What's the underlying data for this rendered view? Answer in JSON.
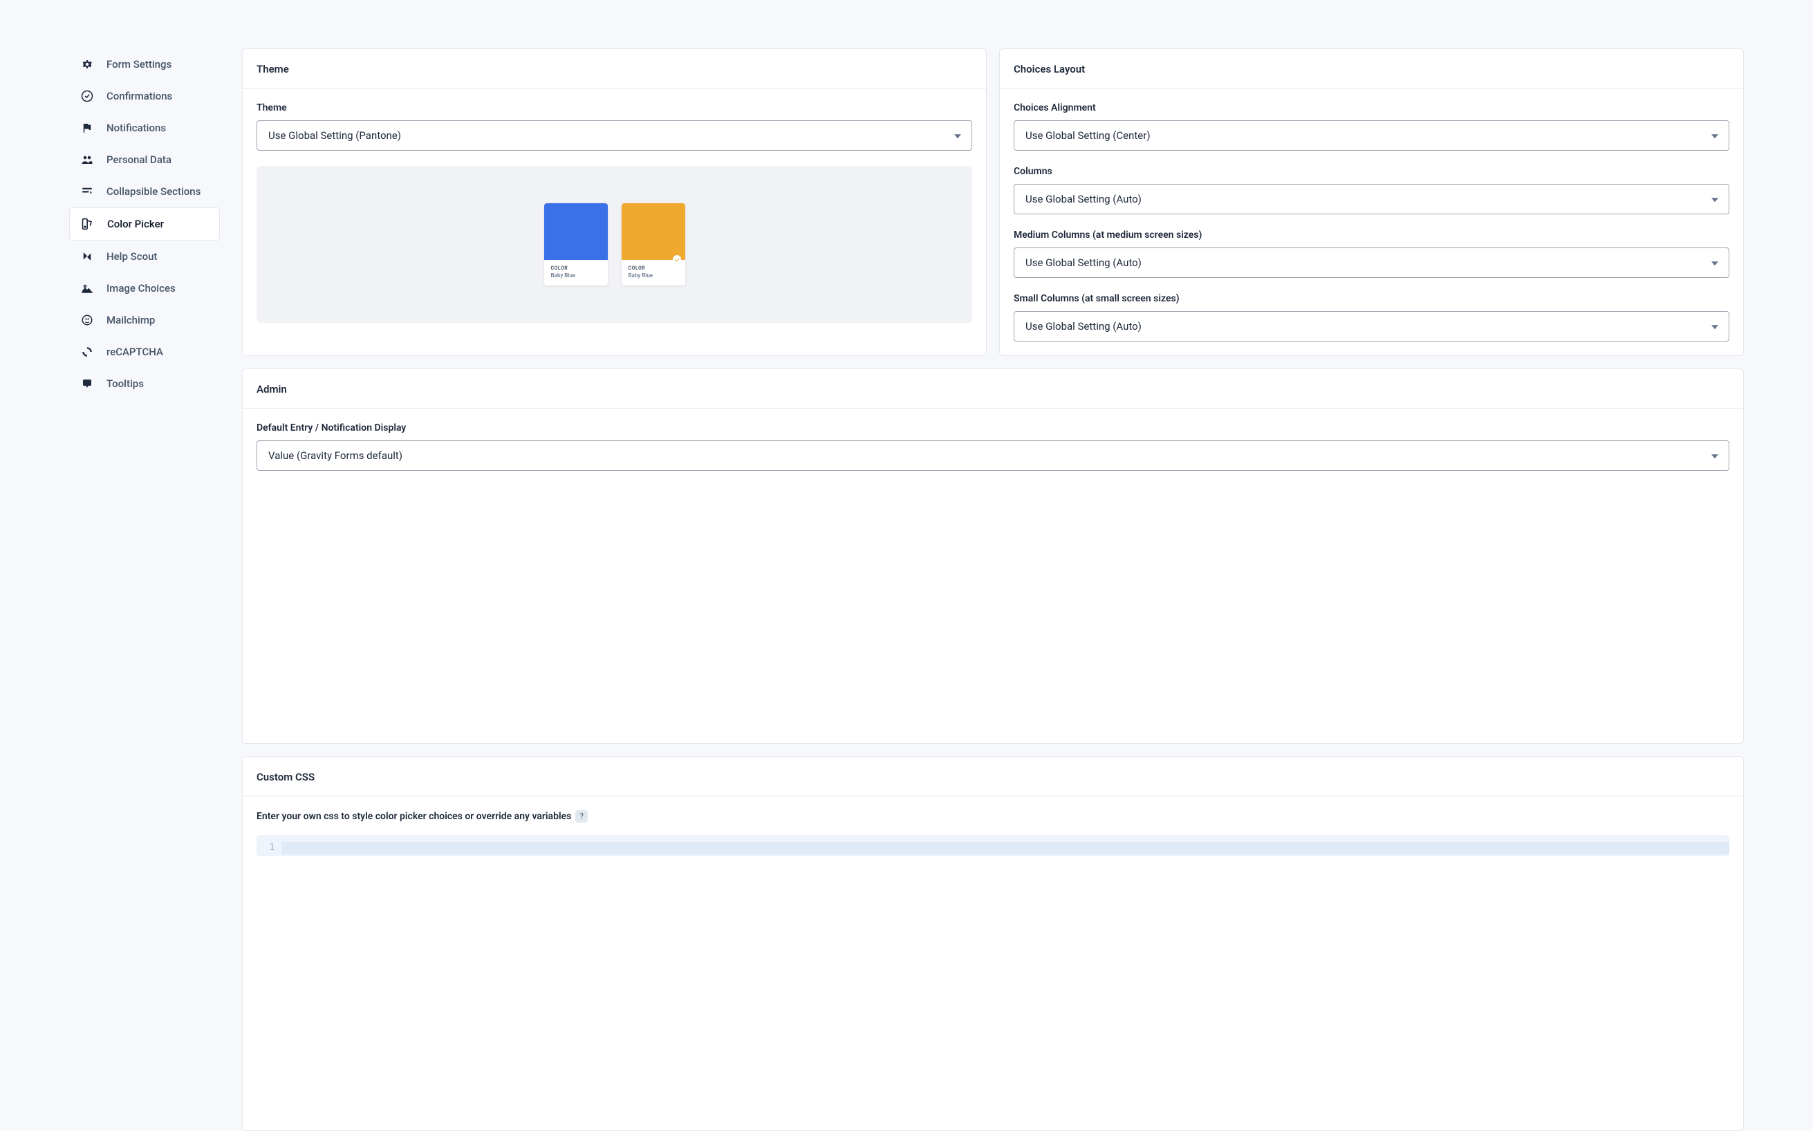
{
  "sidebar": {
    "items": [
      {
        "label": "Form Settings",
        "icon": "gear-icon"
      },
      {
        "label": "Confirmations",
        "icon": "check-circle-icon"
      },
      {
        "label": "Notifications",
        "icon": "flag-icon"
      },
      {
        "label": "Personal Data",
        "icon": "people-icon"
      },
      {
        "label": "Collapsible Sections",
        "icon": "sections-icon"
      },
      {
        "label": "Color Picker",
        "icon": "palette-icon",
        "active": true
      },
      {
        "label": "Help Scout",
        "icon": "helpscout-icon"
      },
      {
        "label": "Image Choices",
        "icon": "image-icon"
      },
      {
        "label": "Mailchimp",
        "icon": "mailchimp-icon"
      },
      {
        "label": "reCAPTCHA",
        "icon": "recaptcha-icon"
      },
      {
        "label": "Tooltips",
        "icon": "tooltip-icon"
      }
    ]
  },
  "theme": {
    "title": "Theme",
    "fields": {
      "theme": {
        "label": "Theme",
        "value": "Use Global Setting (Pantone)"
      }
    },
    "swatches": [
      {
        "category": "COLOR",
        "name": "Baby Blue",
        "color": "#3b71e8",
        "checked": false
      },
      {
        "category": "COLOR",
        "name": "Baby Blue",
        "color": "#f0a92f",
        "checked": true
      }
    ]
  },
  "choices_layout": {
    "title": "Choices Layout",
    "fields": {
      "alignment": {
        "label": "Choices Alignment",
        "value": "Use Global Setting (Center)"
      },
      "columns": {
        "label": "Columns",
        "value": "Use Global Setting (Auto)"
      },
      "medium_columns": {
        "label": "Medium Columns (at medium screen sizes)",
        "value": "Use Global Setting (Auto)"
      },
      "small_columns": {
        "label": "Small Columns (at small screen sizes)",
        "value": "Use Global Setting (Auto)"
      }
    }
  },
  "admin": {
    "title": "Admin",
    "fields": {
      "display": {
        "label": "Default Entry / Notification Display",
        "value": "Value (Gravity Forms default)"
      }
    }
  },
  "custom_css": {
    "title": "Custom CSS",
    "description": "Enter your own css to style color picker choices or override any variables",
    "help_char": "?",
    "line_number": "1"
  }
}
